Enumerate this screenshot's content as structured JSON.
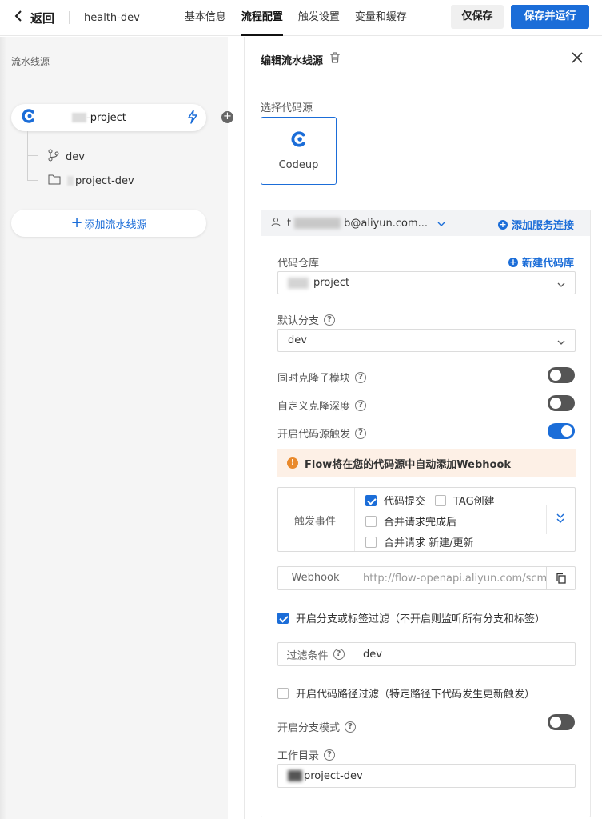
{
  "topbar": {
    "back_label": "返回",
    "project_name": "health-dev",
    "tabs": [
      {
        "label": "基本信息",
        "active": false
      },
      {
        "label": "流程配置",
        "active": true
      },
      {
        "label": "触发设置",
        "active": false
      },
      {
        "label": "变量和缓存",
        "active": false
      }
    ],
    "save_only_label": "仅保存",
    "save_run_label": "保存并运行"
  },
  "left_panel": {
    "title": "流水线源",
    "source": {
      "name_suffix": "-project",
      "icon": "codeup-logo-icon",
      "trigger_icon": "lightning-icon"
    },
    "branch": {
      "label": "dev",
      "icon": "git-branch-icon"
    },
    "workdir": {
      "label": "project-dev",
      "icon": "folder-icon"
    },
    "add_source_label": "添加流水线源"
  },
  "right_panel": {
    "title": "编辑流水线源",
    "select_source_label": "选择代码源",
    "codeup_label": "Codeup",
    "connection": {
      "account_prefix": "t",
      "account_suffix": "b@aliyun.com...",
      "add_connection_label": "添加服务连接"
    },
    "repo": {
      "label": "代码仓库",
      "new_repo_label": "新建代码库",
      "value_suffix": "project"
    },
    "default_branch": {
      "label": "默认分支",
      "value": "dev"
    },
    "clone_submodules": {
      "label": "同时克隆子模块",
      "on": false
    },
    "custom_clone_depth": {
      "label": "自定义克隆深度",
      "on": false
    },
    "source_trigger": {
      "label": "开启代码源触发",
      "on": true
    },
    "alert_text": "Flow将在您的代码源中自动添加Webhook",
    "trigger_events": {
      "label": "触发事件",
      "options": [
        {
          "label": "代码提交",
          "checked": true
        },
        {
          "label": "TAG创建",
          "checked": false
        },
        {
          "label": "合并请求完成后",
          "checked": false
        },
        {
          "label": "合并请求 新建/更新",
          "checked": false
        }
      ]
    },
    "webhook": {
      "label": "Webhook",
      "url": "http://flow-openapi.aliyun.com/scm/"
    },
    "branch_filter": {
      "label": "开启分支或标签过滤（不开启则监听所有分支和标签）",
      "checked": true
    },
    "filter_condition": {
      "label": "过滤条件",
      "value": "dev"
    },
    "path_filter": {
      "label": "开启代码路径过滤（特定路径下代码发生更新触发）",
      "checked": false
    },
    "branch_mode": {
      "label": "开启分支模式",
      "on": false
    },
    "work_dir": {
      "label": "工作目录",
      "value_suffix": "project-dev"
    }
  },
  "colors": {
    "accent": "#1b6dd8",
    "warning": "#e9892b",
    "alert_bg": "#fdf0e6"
  }
}
